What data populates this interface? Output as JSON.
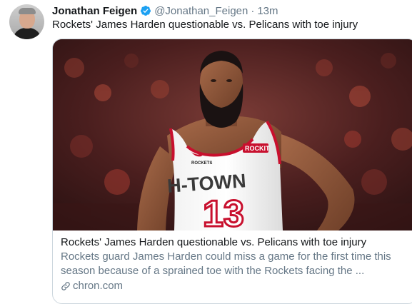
{
  "tweet": {
    "author_name": "Jonathan Feigen",
    "handle": "@Jonathan_Feigen",
    "separator": "·",
    "time": "13m",
    "text": "Rockets' James Harden questionable vs. Pelicans with toe injury"
  },
  "card": {
    "title": "Rockets' James Harden questionable vs. Pelicans with toe injury",
    "description": "Rockets guard James Harden could miss a game for the first time this season because of a sprained toe with the Rockets facing the ...",
    "domain": "chron.com",
    "image": {
      "jersey_brand": "ROCKIT",
      "jersey_word": "H-TOWN",
      "jersey_number": "13",
      "jersey_patch": "ROCKETS"
    }
  },
  "colors": {
    "text_primary": "#14171a",
    "text_secondary": "#657786",
    "border": "#ccd6dd",
    "verified": "#1da1f2",
    "jersey_red": "#c8102e"
  },
  "icons": [
    "verified-badge-icon",
    "link-icon"
  ]
}
